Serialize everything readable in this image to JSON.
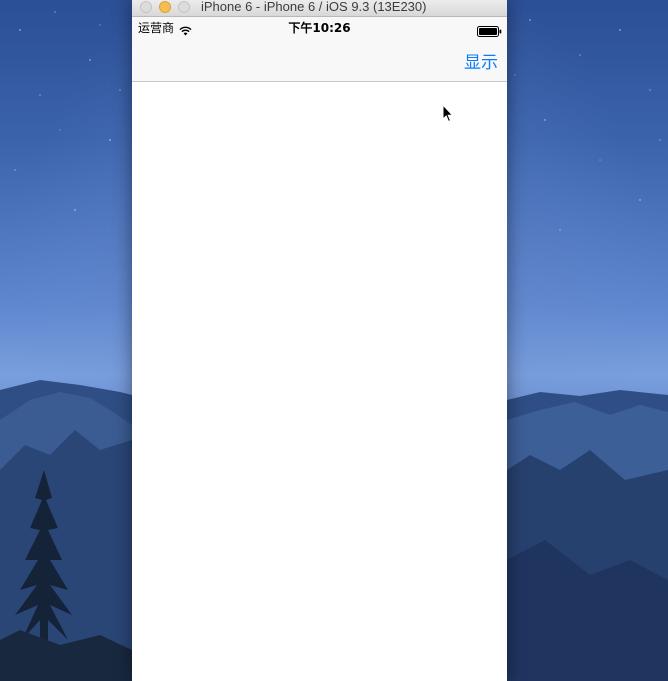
{
  "window": {
    "title": "iPhone 6 - iPhone 6 / iOS 9.3 (13E230)"
  },
  "status_bar": {
    "carrier": "运营商",
    "time": "下午10:26",
    "wifi_icon": "wifi-icon",
    "battery_icon": "battery-icon"
  },
  "nav_bar": {
    "right_button_label": "显示",
    "accent_color": "#0a7aff"
  },
  "desktop": {
    "wallpaper": "night-sky-mountains"
  }
}
